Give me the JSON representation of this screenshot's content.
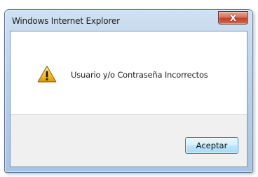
{
  "window": {
    "title": "Windows Internet Explorer",
    "close_glyph": "X",
    "close_icon": "close-icon"
  },
  "dialog": {
    "icon": "warning-icon",
    "message": "Usuario y/o Contraseña Incorrectos",
    "ok_label": "Aceptar"
  },
  "colors": {
    "title_bar": "#b9d1e8",
    "close_button": "#c2412c",
    "button_panel": "#f0f0f0",
    "warning_fill": "#f2c230"
  }
}
